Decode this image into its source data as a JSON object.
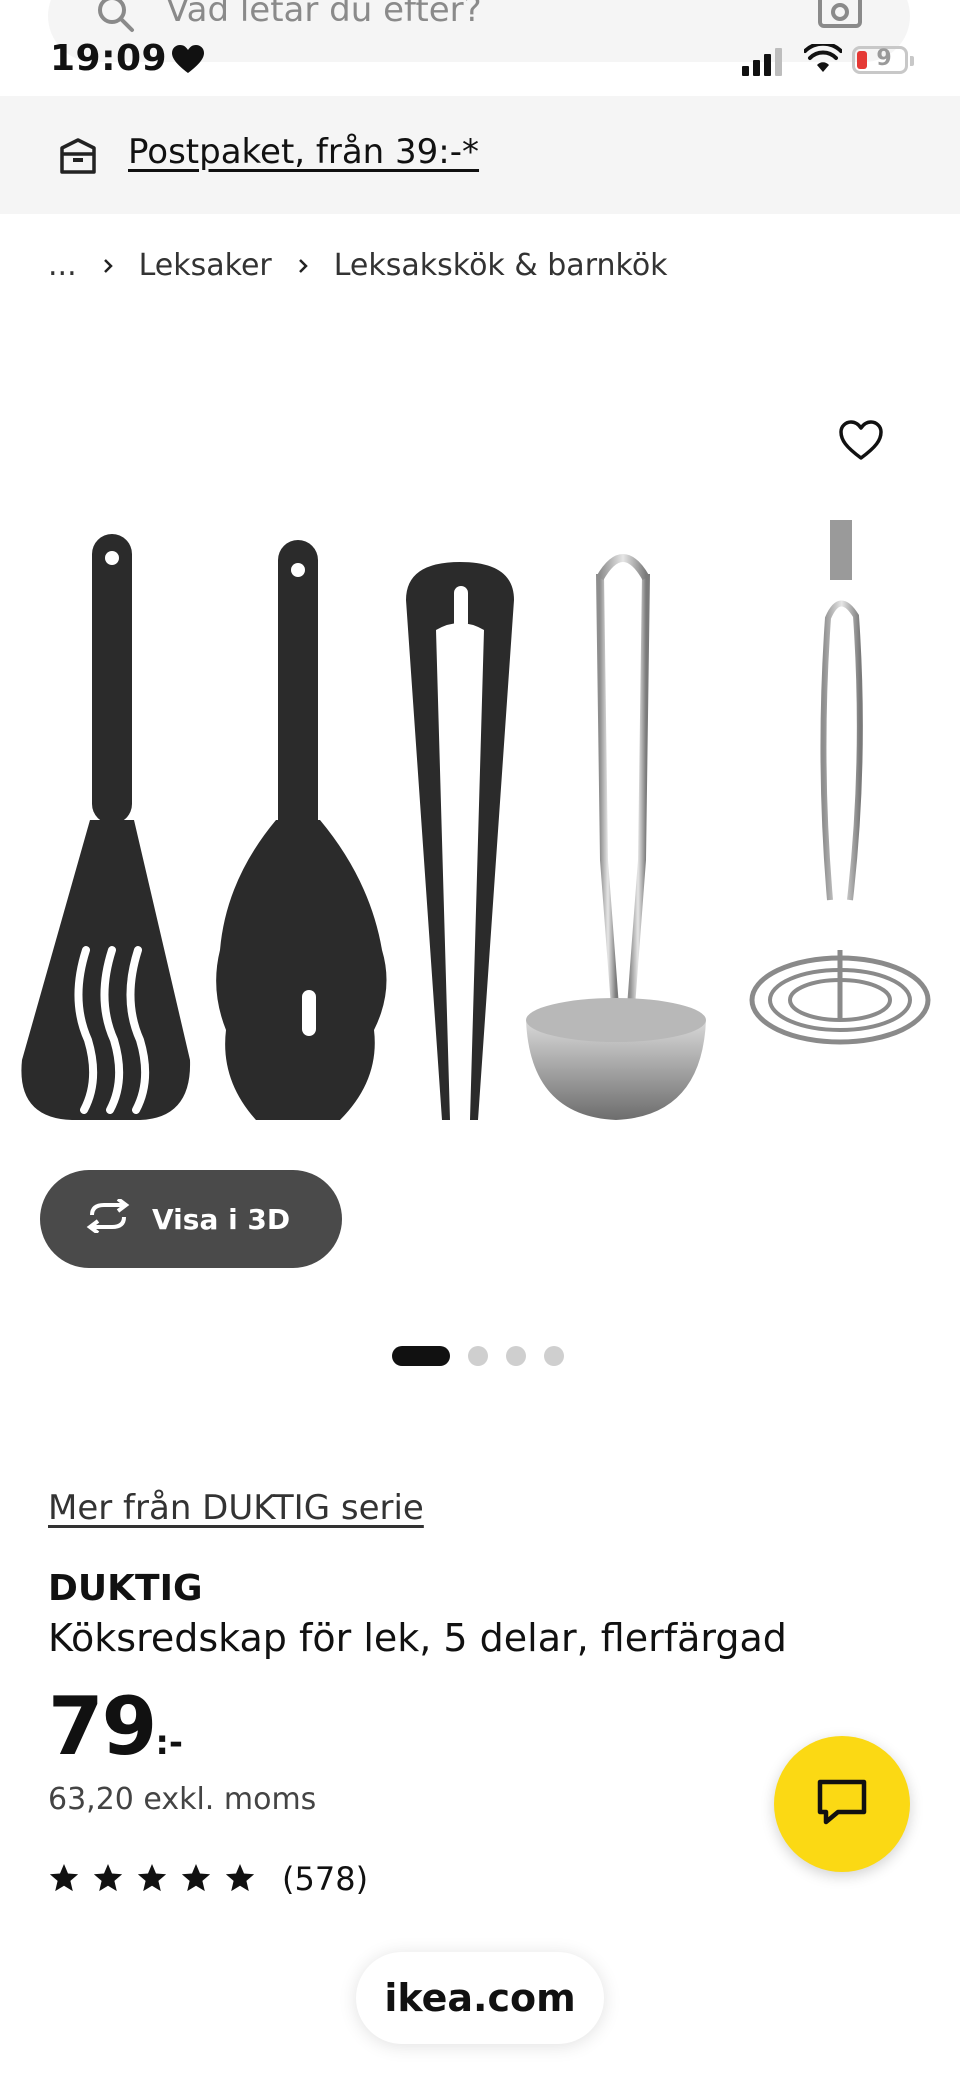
{
  "search": {
    "placeholder": "Vad letar du efter?"
  },
  "status_bar": {
    "time": "19:09",
    "battery": "9"
  },
  "banner": {
    "text": "Postpaket, från 39:-*"
  },
  "breadcrumb": {
    "ellipsis": "...",
    "items": [
      "Leksaker",
      "Leksakskök & barnkök"
    ]
  },
  "gallery": {
    "view3d_label": "Visa i 3D",
    "slide_count": 4,
    "active_slide": 0
  },
  "product": {
    "series_link": "Mer från DUKTIG serie",
    "brand": "DUKTIG",
    "description": "Köksredskap för lek, 5 delar, flerfärgad",
    "price_int": "79",
    "price_suffix": ":-",
    "price_ex_vat": "63,20 exkl. moms",
    "rating": 5,
    "review_count": "(578)"
  },
  "browser": {
    "url": "ikea.com"
  },
  "colors": {
    "chat_button": "#fbd914",
    "view3d_button": "#4a4a4a",
    "banner_bg": "#f5f5f5"
  }
}
